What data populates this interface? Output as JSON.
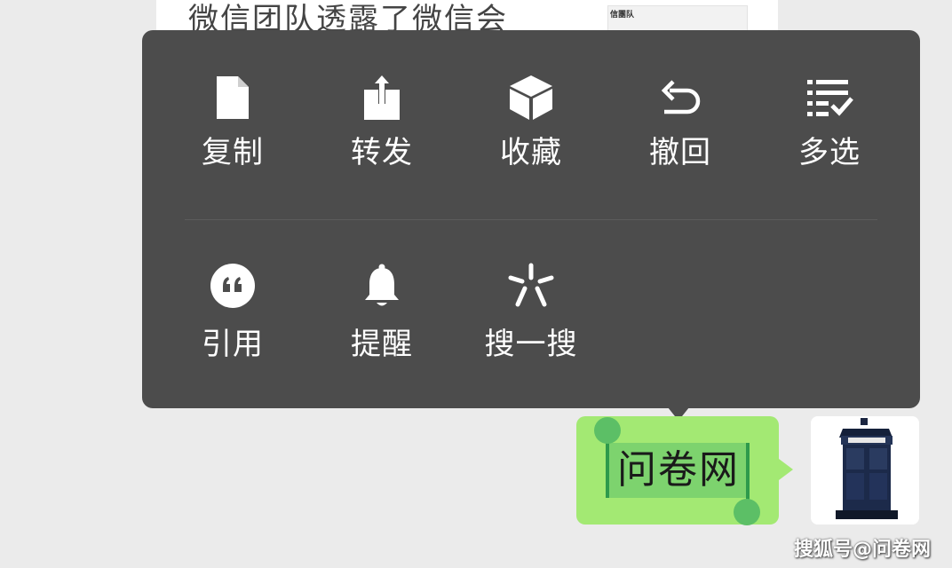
{
  "article": {
    "title": "微信团队透露了微信会",
    "thumb_text": "信團队"
  },
  "menu": {
    "row1": [
      {
        "label": "复制",
        "icon": "document-icon"
      },
      {
        "label": "转发",
        "icon": "share-icon"
      },
      {
        "label": "收藏",
        "icon": "cube-icon"
      },
      {
        "label": "撤回",
        "icon": "undo-icon"
      },
      {
        "label": "多选",
        "icon": "multi-select-icon"
      }
    ],
    "row2": [
      {
        "label": "引用",
        "icon": "quote-icon"
      },
      {
        "label": "提醒",
        "icon": "bell-icon"
      },
      {
        "label": "搜一搜",
        "icon": "search-sparkle-icon"
      }
    ]
  },
  "message": {
    "text": "问卷网",
    "bubble_color": "#a3e973"
  },
  "watermark": "搜狐号@问卷网",
  "colors": {
    "menu_bg": "#4c4c4c",
    "page_bg": "#ebebeb",
    "selection": "#7dd36e",
    "handle": "#5cbf66"
  }
}
